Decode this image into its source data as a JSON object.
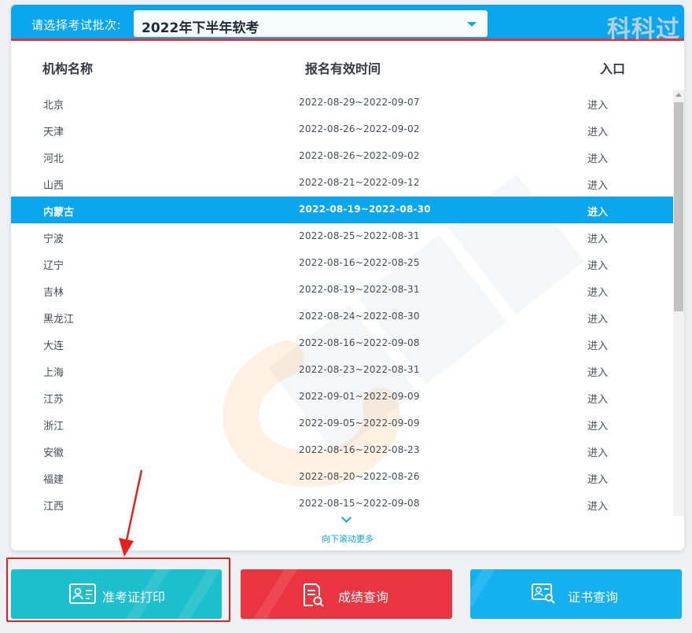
{
  "brand": {
    "watermark_text": "科科过"
  },
  "selector": {
    "label": "请选择考试批次:",
    "value": "2022年下半年软考"
  },
  "table": {
    "headers": {
      "name": "机构名称",
      "time": "报名有效时间",
      "entry": "入口"
    },
    "rows": [
      {
        "name": "北京",
        "time": "2022-08-29~2022-09-07",
        "entry": "进入"
      },
      {
        "name": "天津",
        "time": "2022-08-26~2022-09-02",
        "entry": "进入"
      },
      {
        "name": "河北",
        "time": "2022-08-26~2022-09-02",
        "entry": "进入"
      },
      {
        "name": "山西",
        "time": "2022-08-21~2022-09-12",
        "entry": "进入"
      },
      {
        "name": "内蒙古",
        "time": "2022-08-19~2022-08-30",
        "entry": "进入",
        "active": true
      },
      {
        "name": "宁波",
        "time": "2022-08-25~2022-08-31",
        "entry": "进入"
      },
      {
        "name": "辽宁",
        "time": "2022-08-16~2022-08-25",
        "entry": "进入"
      },
      {
        "name": "吉林",
        "time": "2022-08-19~2022-08-31",
        "entry": "进入"
      },
      {
        "name": "黑龙江",
        "time": "2022-08-24~2022-08-30",
        "entry": "进入"
      },
      {
        "name": "大连",
        "time": "2022-08-16~2022-09-08",
        "entry": "进入"
      },
      {
        "name": "上海",
        "time": "2022-08-23~2022-08-31",
        "entry": "进入"
      },
      {
        "name": "江苏",
        "time": "2022-09-01~2022-09-09",
        "entry": "进入"
      },
      {
        "name": "浙江",
        "time": "2022-09-05~2022-09-09",
        "entry": "进入"
      },
      {
        "name": "安徽",
        "time": "2022-08-16~2022-08-23",
        "entry": "进入"
      },
      {
        "name": "福建",
        "time": "2022-08-20~2022-08-26",
        "entry": "进入"
      },
      {
        "name": "江西",
        "time": "2022-08-15~2022-09-08",
        "entry": "进入"
      }
    ]
  },
  "scroll_hint": "向下滚动更多",
  "buttons": {
    "admit_card": "准考证打印",
    "score_query": "成绩查询",
    "cert_query": "证书查询"
  },
  "colors": {
    "primary": "#0aa6ee",
    "accent_red": "#e4343c",
    "admit_button": "#1cc0cc",
    "score_button": "#ea3540",
    "cert_button": "#14b1f0",
    "highlight": "#e8201c"
  },
  "icons": {
    "select_caret": "chevron-down-icon",
    "scroll_more": "chevron-down-icon",
    "admit_card": "id-card-icon",
    "score_query": "document-search-icon",
    "cert_query": "certificate-search-icon"
  }
}
